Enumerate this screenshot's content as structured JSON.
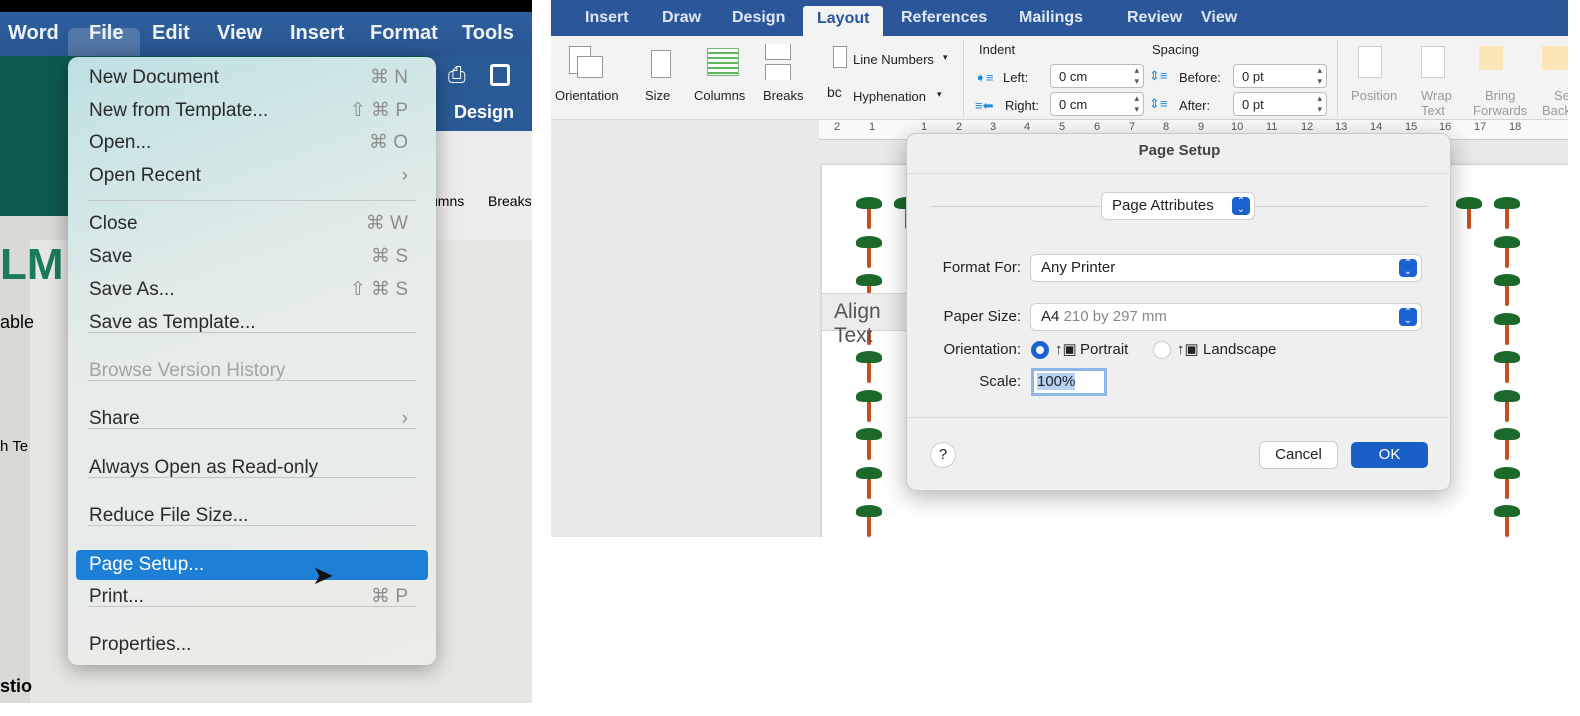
{
  "photo": {
    "menubar": [
      "Word",
      "File",
      "Edit",
      "View",
      "Insert",
      "Format",
      "Tools"
    ],
    "background": {
      "design_tab": "Design",
      "columns": "umns",
      "breaks": "Breaks",
      "doc_text": [
        "LM",
        "able",
        "h Te",
        "stio"
      ]
    },
    "menu": {
      "items": [
        {
          "label": "New Document",
          "shortcut": "⌘ N"
        },
        {
          "label": "New from Template...",
          "shortcut": "⇧ ⌘ P"
        },
        {
          "label": "Open...",
          "shortcut": "⌘ O"
        },
        {
          "label": "Open Recent",
          "shortcut": "›"
        },
        {
          "label": "Close",
          "shortcut": "⌘ W"
        },
        {
          "label": "Save",
          "shortcut": "⌘ S"
        },
        {
          "label": "Save As...",
          "shortcut": "⇧ ⌘ S"
        },
        {
          "label": "Save as Template...",
          "shortcut": ""
        },
        {
          "label": "Browse Version History",
          "shortcut": "",
          "disabled": true
        },
        {
          "label": "Share",
          "shortcut": "›"
        },
        {
          "label": "Always Open as Read-only",
          "shortcut": ""
        },
        {
          "label": "Reduce File Size...",
          "shortcut": ""
        },
        {
          "label": "Page Setup...",
          "shortcut": "",
          "highlighted": true
        },
        {
          "label": "Print...",
          "shortcut": "⌘ P"
        },
        {
          "label": "Properties...",
          "shortcut": ""
        }
      ]
    }
  },
  "word": {
    "tabs": [
      "Insert",
      "Draw",
      "Design",
      "Layout",
      "References",
      "Mailings",
      "Review",
      "View"
    ],
    "active_tab": "Layout",
    "ribbon": {
      "orientation": "Orientation",
      "size": "Size",
      "columns": "Columns",
      "breaks": "Breaks",
      "line_numbers": "Line Numbers",
      "hyphenation": "Hyphenation",
      "indent": {
        "title": "Indent",
        "left_label": "Left:",
        "left": "0 cm",
        "right_label": "Right:",
        "right": "0 cm"
      },
      "spacing": {
        "title": "Spacing",
        "before_label": "Before:",
        "before": "0 pt",
        "after_label": "After:",
        "after": "0 pt"
      },
      "position": "Position",
      "wrap_text": [
        "Wrap",
        "Text"
      ],
      "bring_forwards": [
        "Bring",
        "Forwards"
      ],
      "send_backward": [
        "Se",
        "Back"
      ]
    },
    "ruler": [
      "2",
      "1",
      "1",
      "2",
      "3",
      "4",
      "5",
      "6",
      "7",
      "8",
      "9",
      "10",
      "11",
      "12",
      "13",
      "14",
      "15",
      "16",
      "17",
      "18"
    ],
    "tooltip": "Align Text",
    "dialog": {
      "title": "Page Setup",
      "section": "Page Attributes",
      "format_for_label": "Format For:",
      "format_for": "Any Printer",
      "paper_size_label": "Paper Size:",
      "paper_size": "A4",
      "paper_size_detail": "210 by 297 mm",
      "orientation_label": "Orientation:",
      "portrait": "Portrait",
      "landscape": "Landscape",
      "orientation_selected": "Portrait",
      "scale_label": "Scale:",
      "scale": "100%",
      "help": "?",
      "cancel": "Cancel",
      "ok": "OK"
    },
    "colors": {
      "tab_bar": "#2b579a",
      "ok_button": "#1a5fc7",
      "highlight": "#1e7fd6"
    }
  }
}
